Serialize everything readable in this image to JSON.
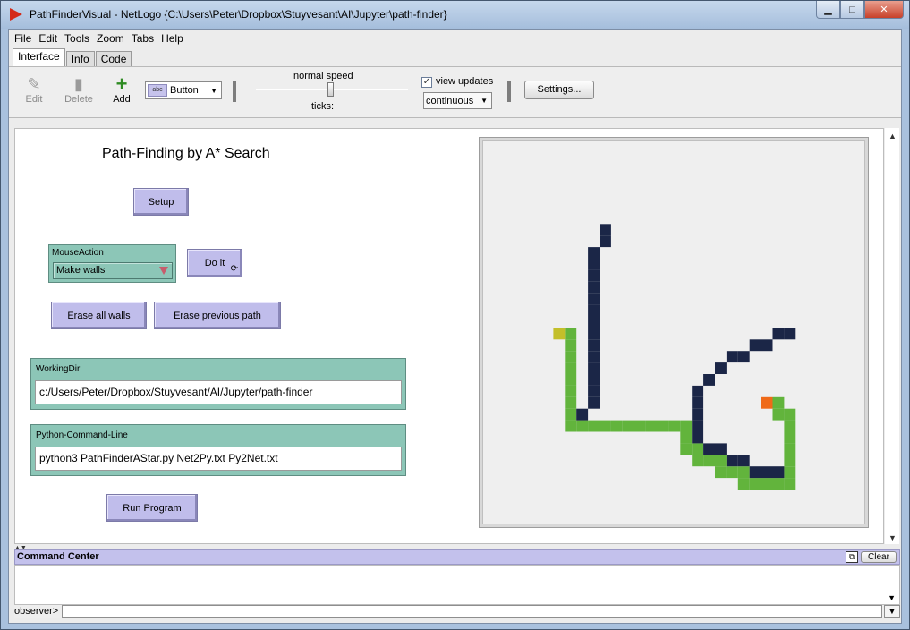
{
  "window": {
    "title": "PathFinderVisual - NetLogo {C:\\Users\\Peter\\Dropbox\\Stuyvesant\\AI\\Jupyter\\path-finder}",
    "minimize_glyph": "▁",
    "maximize_glyph": "□",
    "close_glyph": "✕"
  },
  "menu": [
    "File",
    "Edit",
    "Tools",
    "Zoom",
    "Tabs",
    "Help"
  ],
  "tabs": [
    {
      "label": "Interface",
      "active": true
    },
    {
      "label": "Info",
      "active": false
    },
    {
      "label": "Code",
      "active": false
    }
  ],
  "toolbar": {
    "edit_label": "Edit",
    "delete_label": "Delete",
    "add_label": "Add",
    "widget_type": "Button",
    "widget_chip": "abc",
    "speed_label": "normal speed",
    "ticks_label": "ticks:",
    "view_updates_label": "view updates",
    "view_updates_checked": true,
    "update_mode": "continuous",
    "settings_label": "Settings..."
  },
  "interface": {
    "title": "Path-Finding by A* Search",
    "setup_button": "Setup",
    "mouse_action": {
      "label": "MouseAction",
      "value": "Make walls"
    },
    "do_it_button": "Do it",
    "erase_walls_button": "Erase all walls",
    "erase_path_button": "Erase previous path",
    "working_dir": {
      "label": "WorkingDir",
      "value": "c:/Users/Peter/Dropbox/Stuyvesant/AI/Jupyter/path-finder"
    },
    "python_command": {
      "label": "Python-Command-Line",
      "value": "python3 PathFinderAStar.py Net2Py.txt Py2Net.txt"
    },
    "run_button": "Run Program"
  },
  "world_view": {
    "colors": {
      "wall": "#1b2647",
      "path": "#62b43c",
      "start": "#c3bf2a",
      "goal": "#ef6a18",
      "background": "#efefef"
    },
    "wall_cells": [
      [
        10,
        7
      ],
      [
        10,
        8
      ],
      [
        9,
        9
      ],
      [
        9,
        10
      ],
      [
        9,
        11
      ],
      [
        9,
        12
      ],
      [
        9,
        13
      ],
      [
        9,
        14
      ],
      [
        9,
        15
      ],
      [
        9,
        16
      ],
      [
        9,
        17
      ],
      [
        9,
        18
      ],
      [
        9,
        19
      ],
      [
        9,
        20
      ],
      [
        9,
        21
      ],
      [
        9,
        22
      ],
      [
        8,
        23
      ],
      [
        25,
        16
      ],
      [
        26,
        16
      ],
      [
        23,
        17
      ],
      [
        24,
        17
      ],
      [
        21,
        18
      ],
      [
        22,
        18
      ],
      [
        20,
        19
      ],
      [
        19,
        20
      ],
      [
        18,
        21
      ],
      [
        18,
        22
      ],
      [
        18,
        23
      ],
      [
        18,
        24
      ],
      [
        18,
        25
      ],
      [
        19,
        26
      ],
      [
        20,
        26
      ],
      [
        21,
        27
      ],
      [
        22,
        27
      ],
      [
        23,
        28
      ],
      [
        24,
        28
      ],
      [
        25,
        28
      ]
    ],
    "path_cells": [
      [
        7,
        16
      ],
      [
        7,
        17
      ],
      [
        7,
        18
      ],
      [
        7,
        19
      ],
      [
        7,
        20
      ],
      [
        7,
        21
      ],
      [
        7,
        22
      ],
      [
        7,
        23
      ],
      [
        7,
        24
      ],
      [
        8,
        24
      ],
      [
        9,
        24
      ],
      [
        10,
        24
      ],
      [
        11,
        24
      ],
      [
        12,
        24
      ],
      [
        13,
        24
      ],
      [
        14,
        24
      ],
      [
        15,
        24
      ],
      [
        16,
        24
      ],
      [
        17,
        24
      ],
      [
        17,
        25
      ],
      [
        17,
        26
      ],
      [
        18,
        26
      ],
      [
        18,
        27
      ],
      [
        19,
        27
      ],
      [
        20,
        27
      ],
      [
        20,
        28
      ],
      [
        21,
        28
      ],
      [
        22,
        28
      ],
      [
        22,
        29
      ],
      [
        23,
        29
      ],
      [
        24,
        29
      ],
      [
        25,
        29
      ],
      [
        26,
        29
      ],
      [
        26,
        28
      ],
      [
        26,
        27
      ],
      [
        26,
        26
      ],
      [
        26,
        25
      ],
      [
        26,
        24
      ],
      [
        26,
        23
      ],
      [
        25,
        23
      ],
      [
        25,
        22
      ]
    ],
    "start_cell": [
      6,
      16
    ],
    "goal_cell": [
      24,
      22
    ]
  },
  "command_center": {
    "title": "Command Center",
    "clear_label": "Clear",
    "prompt": "observer>",
    "input_value": ""
  }
}
